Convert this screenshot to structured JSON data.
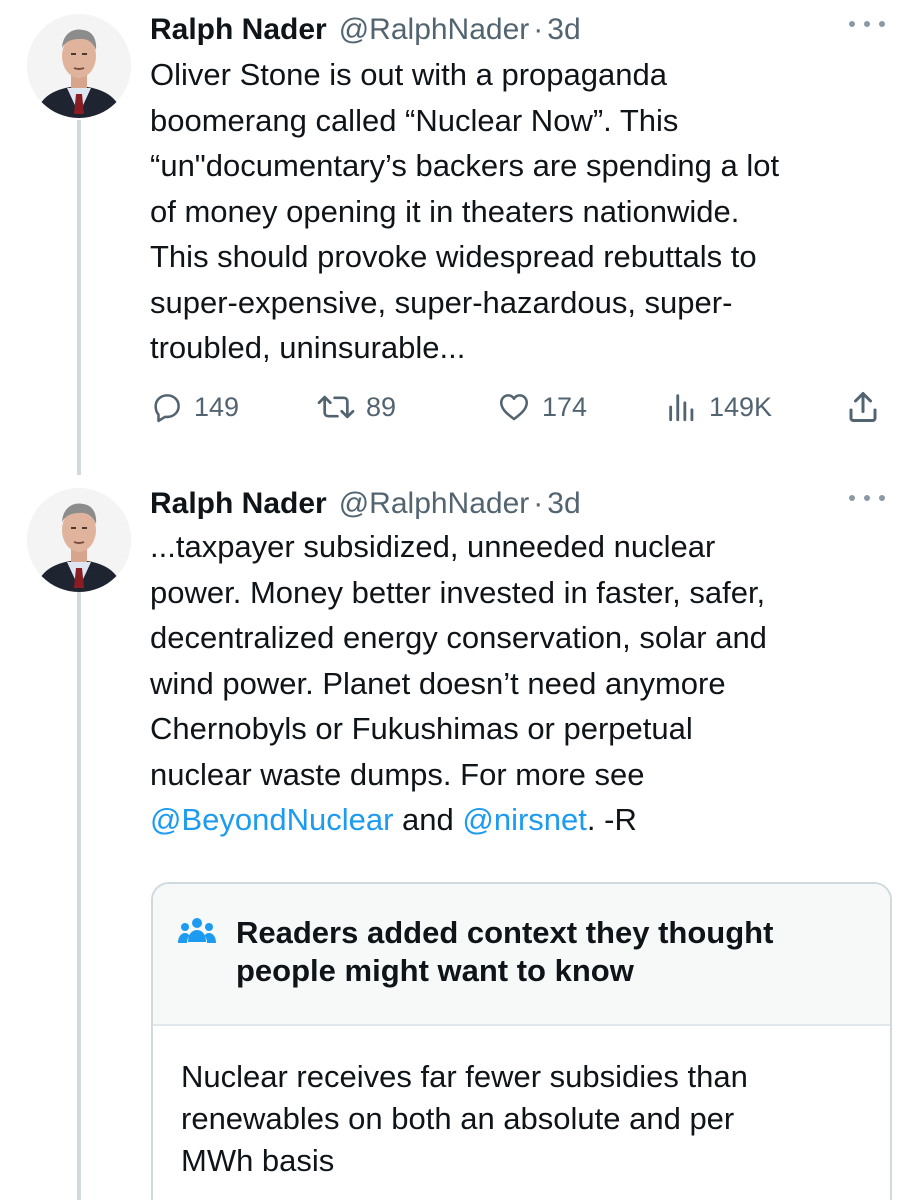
{
  "tweets": [
    {
      "author": {
        "name": "Ralph Nader",
        "handle": "@RalphNader",
        "separator": "·",
        "time": "3d"
      },
      "text_lines": [
        "Oliver Stone is out with a propaganda",
        "boomerang called “Nuclear Now”. This",
        "“un\"documentary’s backers are spending a lot",
        "of money opening it in theaters nationwide.",
        "This should provoke widespread rebuttals to",
        "super-expensive, super-hazardous, super-",
        "troubled, uninsurable..."
      ],
      "stats": {
        "replies": "149",
        "retweets": "89",
        "likes": "174",
        "views": "149K"
      }
    },
    {
      "author": {
        "name": "Ralph Nader",
        "handle": "@RalphNader",
        "separator": "·",
        "time": "3d"
      },
      "text_lines": [
        "...taxpayer subsidized, unneeded nuclear",
        "power. Money better invested in faster, safer,",
        "decentralized energy conservation, solar and",
        "wind power. Planet doesn’t need anymore",
        "Chernobyls or Fukushimas or perpetual",
        "nuclear waste dumps. For more see"
      ],
      "last_line": {
        "mention_1": "@BeyondNuclear",
        "connector": " and ",
        "mention_2": "@nirsnet",
        "tail": ". -R"
      }
    }
  ],
  "community_note": {
    "title_lines": [
      "Readers added context they thought",
      "people might want to know"
    ],
    "body_lines": [
      "Nuclear receives far fewer subsidies than",
      "renewables on both an absolute and per",
      "MWh basis"
    ]
  },
  "colors": {
    "text": "#0f1419",
    "secondary": "#536471",
    "link": "#1d9bf0",
    "border": "#cfd9de"
  },
  "icons": {
    "reply": "reply-icon",
    "retweet": "retweet-icon",
    "like": "heart-icon",
    "views": "views-icon",
    "share": "share-icon",
    "more": "more-icon",
    "note": "people-icon"
  }
}
